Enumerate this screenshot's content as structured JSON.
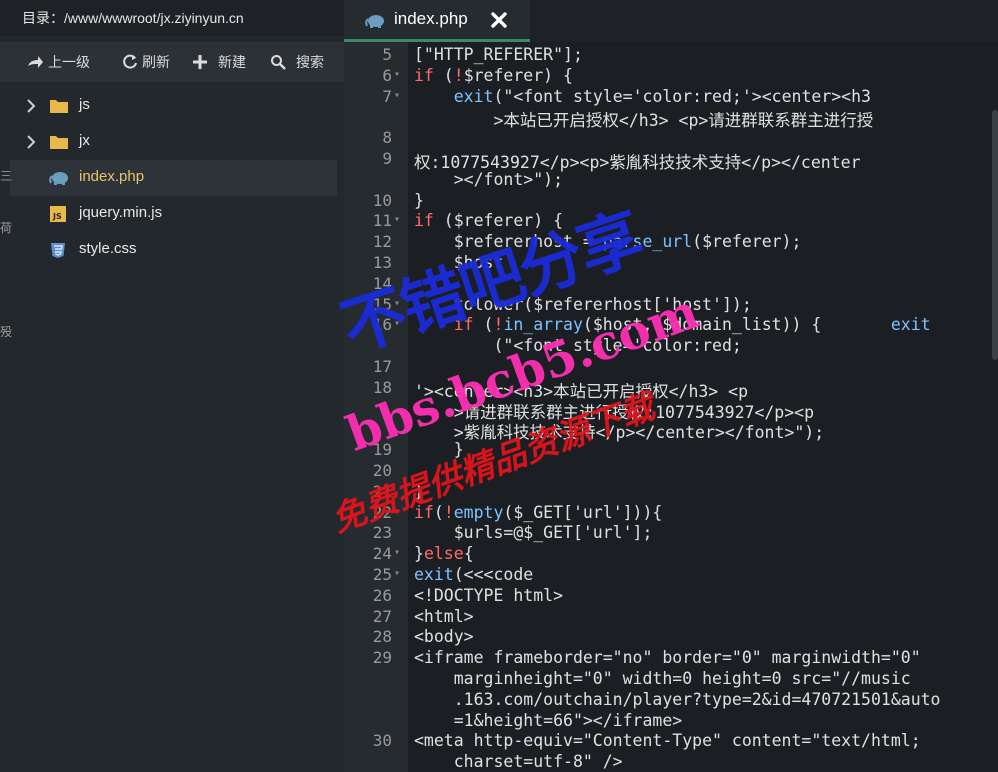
{
  "sidebar": {
    "path_label": "目录：/www/wwwroot/jx.ziyinyun.cn",
    "toolbar": {
      "up": "上一级",
      "refresh": "刷新",
      "new": "新建",
      "search": "搜索"
    },
    "tree": [
      {
        "label": "js",
        "type": "folder"
      },
      {
        "label": "jx",
        "type": "folder"
      },
      {
        "label": "index.php",
        "type": "php",
        "active": true
      },
      {
        "label": "jquery.min.js",
        "type": "js"
      },
      {
        "label": "style.css",
        "type": "css"
      }
    ]
  },
  "editor": {
    "tab": {
      "title": "index.php"
    },
    "lines": [
      {
        "n": "5",
        "fold": false,
        "text": "[\"HTTP_REFERER\"];"
      },
      {
        "n": "6",
        "fold": true,
        "text": "if (!$referer) {"
      },
      {
        "n": "7",
        "fold": true,
        "text": "    exit(\"<font style='color:red;'><center><h3"
      },
      {
        "n": "",
        "fold": false,
        "text": "        >本站已开启授权</h3> <p>请进群联系群主进行授"
      },
      {
        "n": "8",
        "fold": false,
        "text": ""
      },
      {
        "n": "9",
        "fold": false,
        "text": "权:1077543927</p><p>紫胤科技技术支持</p></center"
      },
      {
        "n": "",
        "fold": false,
        "text": "    ></font>\");"
      },
      {
        "n": "10",
        "fold": false,
        "text": "}"
      },
      {
        "n": "11",
        "fold": true,
        "text": "if ($referer) {"
      },
      {
        "n": "12",
        "fold": false,
        "text": "    $refererhost = parse_url($referer);"
      },
      {
        "n": "13",
        "fold": false,
        "text": "    $host"
      },
      {
        "n": "14",
        "fold": false,
        "text": ""
      },
      {
        "n": "15",
        "fold": true,
        "text": "    tolower($refererhost['host']);"
      },
      {
        "n": "16",
        "fold": true,
        "text": "    if (!in_array($host, $domain_list)) {       exit"
      },
      {
        "n": "",
        "fold": false,
        "text": "        (\"<font style='color:red;"
      },
      {
        "n": "17",
        "fold": false,
        "text": ""
      },
      {
        "n": "18",
        "fold": false,
        "text": "'><center><h3>本站已开启授权</h3> <p"
      },
      {
        "n": "",
        "fold": false,
        "text": "    >请进群联系群主进行授权:1077543927</p><p"
      },
      {
        "n": "",
        "fold": false,
        "text": "    >紫胤科技技术支持</p></center></font>\");"
      },
      {
        "n": "19",
        "fold": false,
        "text": "    }"
      },
      {
        "n": "20",
        "fold": false,
        "text": ""
      },
      {
        "n": "21",
        "fold": false,
        "text": "}"
      },
      {
        "n": "22",
        "fold": true,
        "text": "if(!empty($_GET['url'])){"
      },
      {
        "n": "23",
        "fold": false,
        "text": "    $urls=@$_GET['url'];"
      },
      {
        "n": "24",
        "fold": true,
        "text": "}else{"
      },
      {
        "n": "25",
        "fold": true,
        "text": "exit(<<<code"
      },
      {
        "n": "26",
        "fold": false,
        "text": "<!DOCTYPE html>"
      },
      {
        "n": "27",
        "fold": false,
        "text": "<html>"
      },
      {
        "n": "28",
        "fold": false,
        "text": "<body>"
      },
      {
        "n": "29",
        "fold": false,
        "text": "<iframe frameborder=\"no\" border=\"0\" marginwidth=\"0\""
      },
      {
        "n": "",
        "fold": false,
        "text": "    marginheight=\"0\" width=0 height=0 src=\"//music"
      },
      {
        "n": "",
        "fold": false,
        "text": "    .163.com/outchain/player?type=2&id=470721501&auto"
      },
      {
        "n": "",
        "fold": false,
        "text": "    =1&height=66\"></iframe>"
      },
      {
        "n": "30",
        "fold": false,
        "text": "<meta http-equiv=\"Content-Type\" content=\"text/html;"
      },
      {
        "n": "",
        "fold": false,
        "text": "    charset=utf-8\" />"
      }
    ]
  },
  "watermarks": {
    "line1": "不错吧分享",
    "line2": "bbs.bcb5.com",
    "line3": "免费提供精品资源下载"
  },
  "left_edge_glyphs": "三\n荷\n\n殁",
  "colors": {
    "keyword": "#ff6b6b",
    "function": "#7ec3ff",
    "accent_active": "#e8c66a",
    "watermark_blue": "#1a2bd8",
    "watermark_magenta": "#ff2fb4",
    "watermark_red": "#e0141c"
  }
}
